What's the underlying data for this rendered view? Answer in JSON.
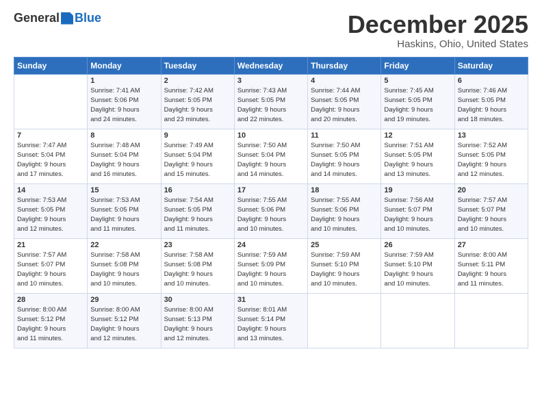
{
  "header": {
    "logo_general": "General",
    "logo_blue": "Blue",
    "month_title": "December 2025",
    "location": "Haskins, Ohio, United States"
  },
  "days_of_week": [
    "Sunday",
    "Monday",
    "Tuesday",
    "Wednesday",
    "Thursday",
    "Friday",
    "Saturday"
  ],
  "weeks": [
    [
      {
        "day": "",
        "info": ""
      },
      {
        "day": "1",
        "info": "Sunrise: 7:41 AM\nSunset: 5:06 PM\nDaylight: 9 hours\nand 24 minutes."
      },
      {
        "day": "2",
        "info": "Sunrise: 7:42 AM\nSunset: 5:05 PM\nDaylight: 9 hours\nand 23 minutes."
      },
      {
        "day": "3",
        "info": "Sunrise: 7:43 AM\nSunset: 5:05 PM\nDaylight: 9 hours\nand 22 minutes."
      },
      {
        "day": "4",
        "info": "Sunrise: 7:44 AM\nSunset: 5:05 PM\nDaylight: 9 hours\nand 20 minutes."
      },
      {
        "day": "5",
        "info": "Sunrise: 7:45 AM\nSunset: 5:05 PM\nDaylight: 9 hours\nand 19 minutes."
      },
      {
        "day": "6",
        "info": "Sunrise: 7:46 AM\nSunset: 5:05 PM\nDaylight: 9 hours\nand 18 minutes."
      }
    ],
    [
      {
        "day": "7",
        "info": "Sunrise: 7:47 AM\nSunset: 5:04 PM\nDaylight: 9 hours\nand 17 minutes."
      },
      {
        "day": "8",
        "info": "Sunrise: 7:48 AM\nSunset: 5:04 PM\nDaylight: 9 hours\nand 16 minutes."
      },
      {
        "day": "9",
        "info": "Sunrise: 7:49 AM\nSunset: 5:04 PM\nDaylight: 9 hours\nand 15 minutes."
      },
      {
        "day": "10",
        "info": "Sunrise: 7:50 AM\nSunset: 5:04 PM\nDaylight: 9 hours\nand 14 minutes."
      },
      {
        "day": "11",
        "info": "Sunrise: 7:50 AM\nSunset: 5:05 PM\nDaylight: 9 hours\nand 14 minutes."
      },
      {
        "day": "12",
        "info": "Sunrise: 7:51 AM\nSunset: 5:05 PM\nDaylight: 9 hours\nand 13 minutes."
      },
      {
        "day": "13",
        "info": "Sunrise: 7:52 AM\nSunset: 5:05 PM\nDaylight: 9 hours\nand 12 minutes."
      }
    ],
    [
      {
        "day": "14",
        "info": "Sunrise: 7:53 AM\nSunset: 5:05 PM\nDaylight: 9 hours\nand 12 minutes."
      },
      {
        "day": "15",
        "info": "Sunrise: 7:53 AM\nSunset: 5:05 PM\nDaylight: 9 hours\nand 11 minutes."
      },
      {
        "day": "16",
        "info": "Sunrise: 7:54 AM\nSunset: 5:05 PM\nDaylight: 9 hours\nand 11 minutes."
      },
      {
        "day": "17",
        "info": "Sunrise: 7:55 AM\nSunset: 5:06 PM\nDaylight: 9 hours\nand 10 minutes."
      },
      {
        "day": "18",
        "info": "Sunrise: 7:55 AM\nSunset: 5:06 PM\nDaylight: 9 hours\nand 10 minutes."
      },
      {
        "day": "19",
        "info": "Sunrise: 7:56 AM\nSunset: 5:07 PM\nDaylight: 9 hours\nand 10 minutes."
      },
      {
        "day": "20",
        "info": "Sunrise: 7:57 AM\nSunset: 5:07 PM\nDaylight: 9 hours\nand 10 minutes."
      }
    ],
    [
      {
        "day": "21",
        "info": "Sunrise: 7:57 AM\nSunset: 5:07 PM\nDaylight: 9 hours\nand 10 minutes."
      },
      {
        "day": "22",
        "info": "Sunrise: 7:58 AM\nSunset: 5:08 PM\nDaylight: 9 hours\nand 10 minutes."
      },
      {
        "day": "23",
        "info": "Sunrise: 7:58 AM\nSunset: 5:08 PM\nDaylight: 9 hours\nand 10 minutes."
      },
      {
        "day": "24",
        "info": "Sunrise: 7:59 AM\nSunset: 5:09 PM\nDaylight: 9 hours\nand 10 minutes."
      },
      {
        "day": "25",
        "info": "Sunrise: 7:59 AM\nSunset: 5:10 PM\nDaylight: 9 hours\nand 10 minutes."
      },
      {
        "day": "26",
        "info": "Sunrise: 7:59 AM\nSunset: 5:10 PM\nDaylight: 9 hours\nand 10 minutes."
      },
      {
        "day": "27",
        "info": "Sunrise: 8:00 AM\nSunset: 5:11 PM\nDaylight: 9 hours\nand 11 minutes."
      }
    ],
    [
      {
        "day": "28",
        "info": "Sunrise: 8:00 AM\nSunset: 5:12 PM\nDaylight: 9 hours\nand 11 minutes."
      },
      {
        "day": "29",
        "info": "Sunrise: 8:00 AM\nSunset: 5:12 PM\nDaylight: 9 hours\nand 12 minutes."
      },
      {
        "day": "30",
        "info": "Sunrise: 8:00 AM\nSunset: 5:13 PM\nDaylight: 9 hours\nand 12 minutes."
      },
      {
        "day": "31",
        "info": "Sunrise: 8:01 AM\nSunset: 5:14 PM\nDaylight: 9 hours\nand 13 minutes."
      },
      {
        "day": "",
        "info": ""
      },
      {
        "day": "",
        "info": ""
      },
      {
        "day": "",
        "info": ""
      }
    ]
  ]
}
